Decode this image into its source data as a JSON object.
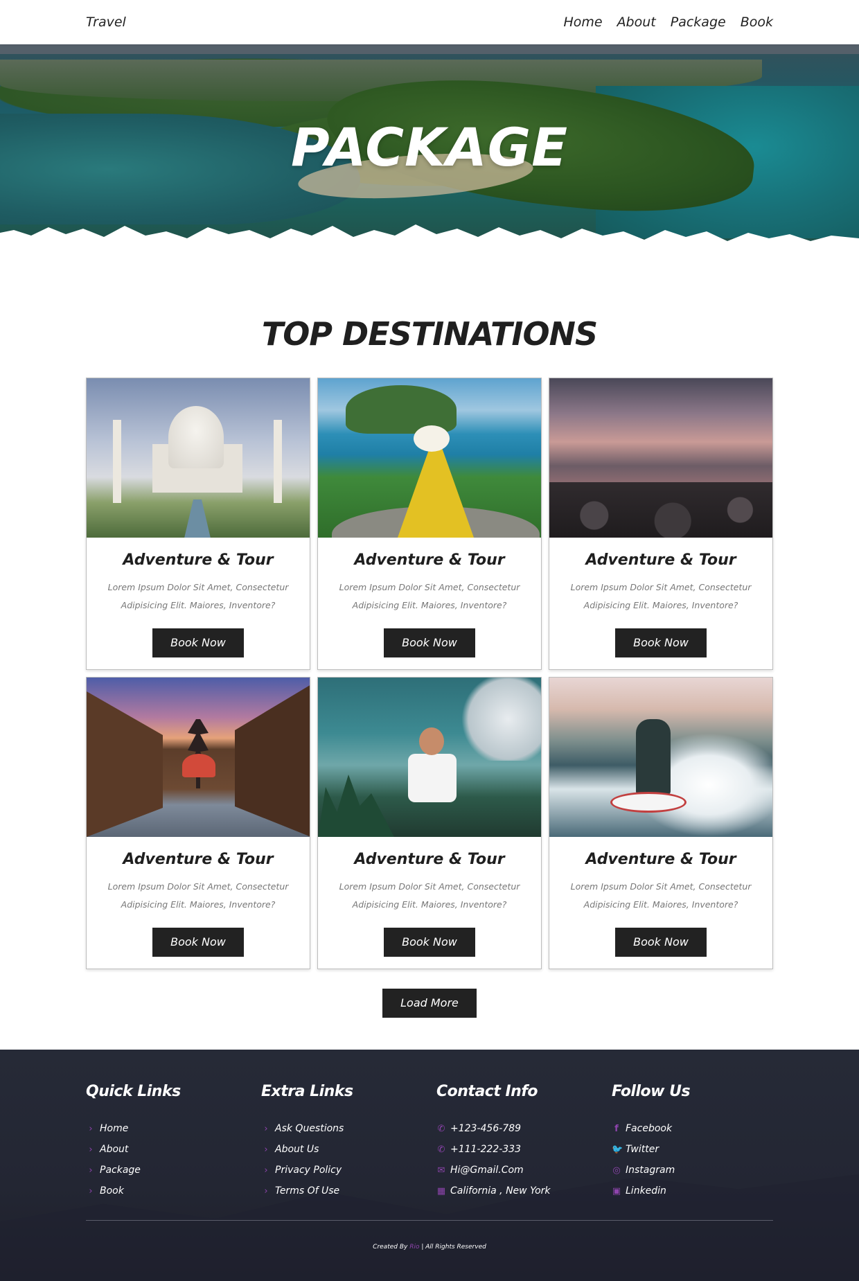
{
  "header": {
    "logo": "Travel",
    "nav": [
      "Home",
      "About",
      "Package",
      "Book"
    ]
  },
  "hero": {
    "title": "PACKAGE"
  },
  "section": {
    "title": "TOP DESTINATIONS"
  },
  "cards": [
    {
      "image": "taj-mahal-image",
      "title": "Adventure & Tour",
      "desc": "Lorem Ipsum Dolor Sit Amet, Consectetur Adipisicing Elit. Maiores, Inventore?",
      "button": "Book Now"
    },
    {
      "image": "island-woman-image",
      "title": "Adventure & Tour",
      "desc": "Lorem Ipsum Dolor Sit Amet, Consectetur Adipisicing Elit. Maiores, Inventore?",
      "button": "Book Now"
    },
    {
      "image": "rocky-sunset-image",
      "title": "Adventure & Tour",
      "desc": "Lorem Ipsum Dolor Sit Amet, Consectetur Adipisicing Elit. Maiores, Inventore?",
      "button": "Book Now"
    },
    {
      "image": "kyoto-street-image",
      "title": "Adventure & Tour",
      "desc": "Lorem Ipsum Dolor Sit Amet, Consectetur Adipisicing Elit. Maiores, Inventore?",
      "button": "Book Now"
    },
    {
      "image": "happy-woman-image",
      "title": "Adventure & Tour",
      "desc": "Lorem Ipsum Dolor Sit Amet, Consectetur Adipisicing Elit. Maiores, Inventore?",
      "button": "Book Now"
    },
    {
      "image": "surfer-image",
      "title": "Adventure & Tour",
      "desc": "Lorem Ipsum Dolor Sit Amet, Consectetur Adipisicing Elit. Maiores, Inventore?",
      "button": "Book Now"
    }
  ],
  "load_more": "Load More",
  "footer": {
    "quick_links": {
      "title": "Quick Links",
      "items": [
        "Home",
        "About",
        "Package",
        "Book"
      ]
    },
    "extra_links": {
      "title": "Extra Links",
      "items": [
        "Ask Questions",
        "About Us",
        "Privacy Policy",
        "Terms Of Use"
      ]
    },
    "contact": {
      "title": "Contact Info",
      "items": [
        {
          "icon": "phone-icon",
          "text": "+123-456-789"
        },
        {
          "icon": "phone-icon",
          "text": "+111-222-333"
        },
        {
          "icon": "envelope-icon",
          "text": "Hi@Gmail.Com"
        },
        {
          "icon": "map-icon",
          "text": "California , New York"
        }
      ]
    },
    "follow": {
      "title": "Follow Us",
      "items": [
        {
          "icon": "facebook-icon",
          "text": "Facebook"
        },
        {
          "icon": "twitter-icon",
          "text": "Twitter"
        },
        {
          "icon": "instagram-icon",
          "text": "Instagram"
        },
        {
          "icon": "linkedin-icon",
          "text": "Linkedin"
        }
      ]
    },
    "credit_prefix": "Created By",
    "credit_brand": "Rio",
    "credit_suffix": "| All Rights Reserved"
  },
  "colors": {
    "accent": "#8e44ad",
    "button": "#222222",
    "footer_bg": "#262a37"
  }
}
